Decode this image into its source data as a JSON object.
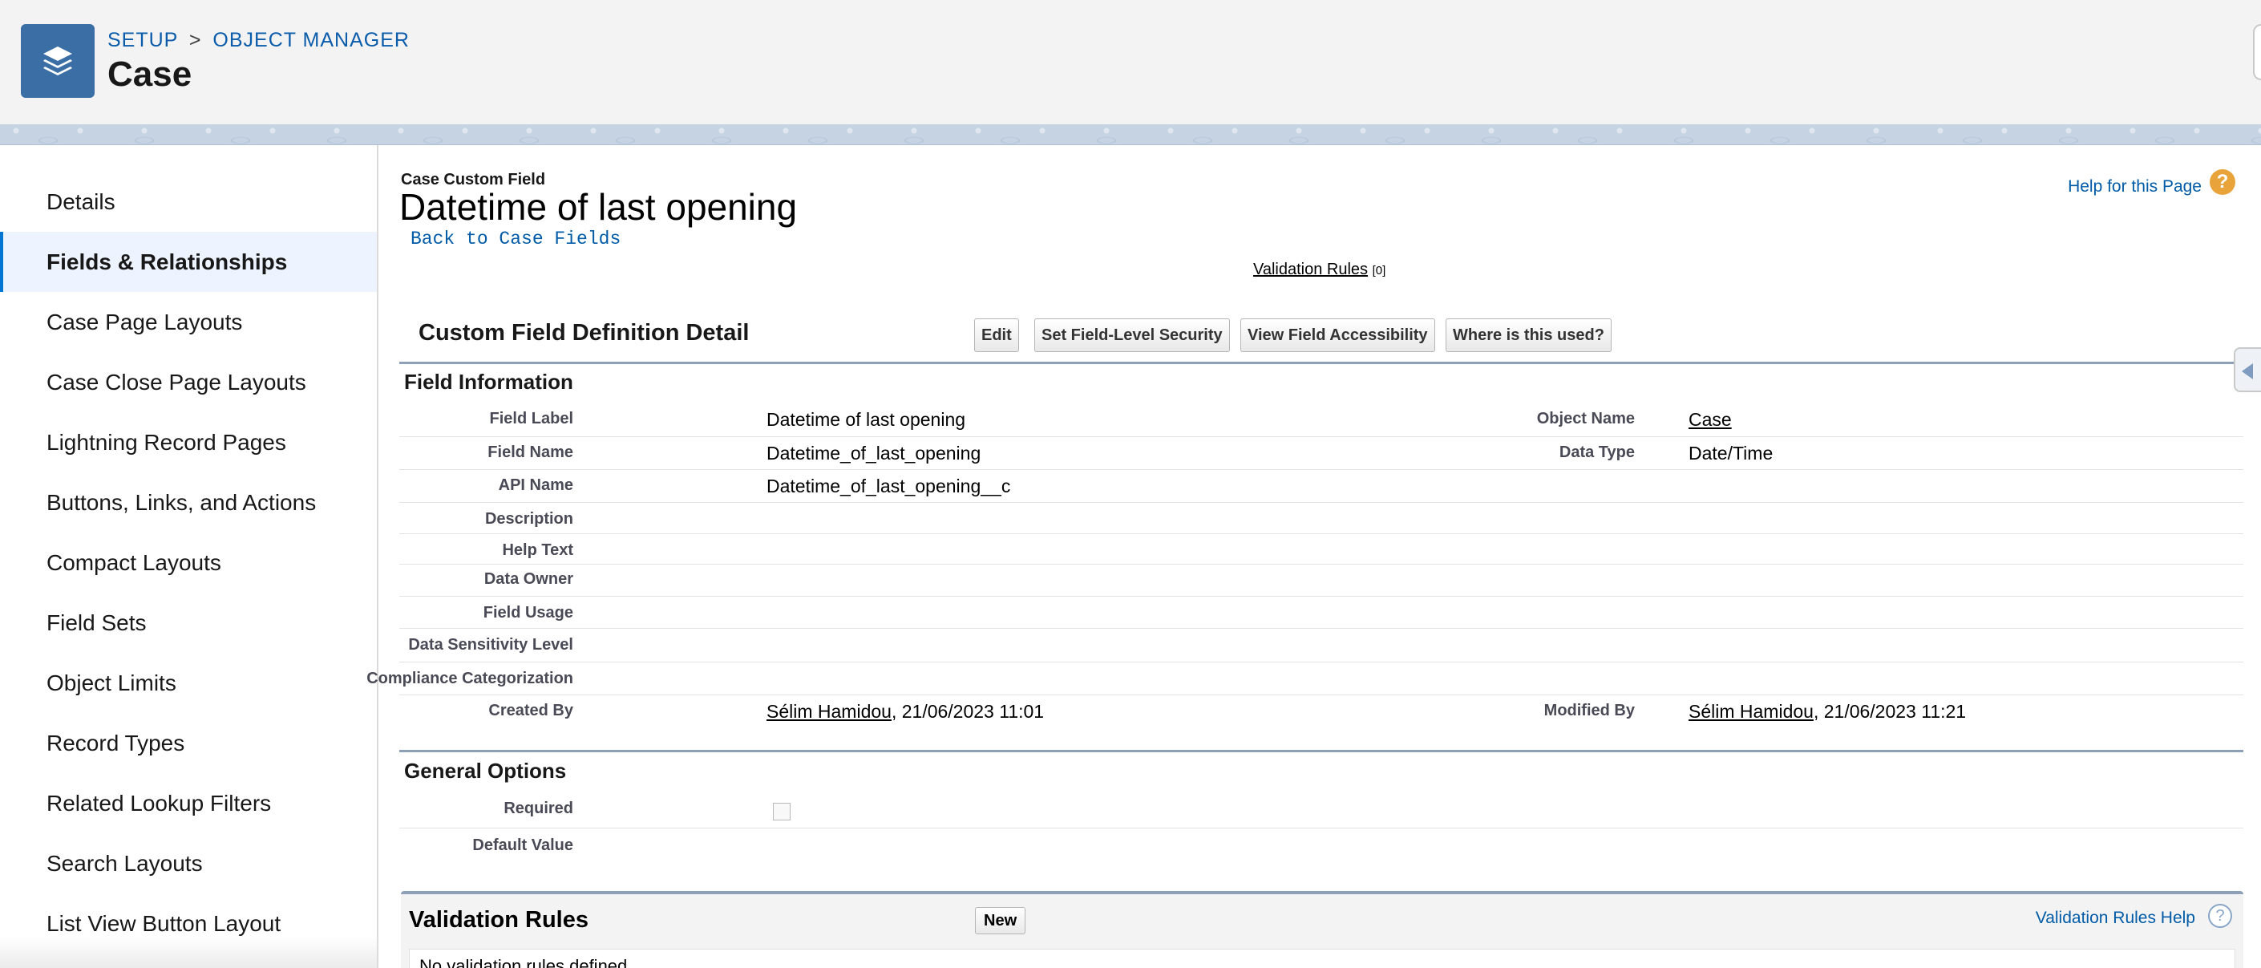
{
  "header": {
    "breadcrumb": [
      "SETUP",
      "OBJECT MANAGER"
    ],
    "separator": ">",
    "object_title": "Case"
  },
  "sidebar": {
    "items": [
      {
        "label": "Details"
      },
      {
        "label": "Fields & Relationships"
      },
      {
        "label": "Case Page Layouts"
      },
      {
        "label": "Case Close Page Layouts"
      },
      {
        "label": "Lightning Record Pages"
      },
      {
        "label": "Buttons, Links, and Actions"
      },
      {
        "label": "Compact Layouts"
      },
      {
        "label": "Field Sets"
      },
      {
        "label": "Object Limits"
      },
      {
        "label": "Record Types"
      },
      {
        "label": "Related Lookup Filters"
      },
      {
        "label": "Search Layouts"
      },
      {
        "label": "List View Button Layout"
      }
    ],
    "active": "Fields & Relationships"
  },
  "page": {
    "pre_title": "Case Custom Field",
    "title": "Datetime of last opening",
    "back_link": "Back to Case Fields",
    "help_link": "Help for this Page",
    "validation_rules_link": "Validation Rules",
    "validation_rules_count": "[0]"
  },
  "detail": {
    "section_title": "Custom Field Definition Detail",
    "buttons": {
      "edit": "Edit",
      "fls": "Set Field-Level Security",
      "accessibility": "View Field Accessibility",
      "where_used": "Where is this used?"
    },
    "field_info_heading": "Field Information",
    "labels": {
      "field_label": "Field Label",
      "field_name": "Field Name",
      "api_name": "API Name",
      "description": "Description",
      "help_text": "Help Text",
      "data_owner": "Data Owner",
      "field_usage": "Field Usage",
      "data_sensitivity": "Data Sensitivity Level",
      "compliance": "Compliance Categorization",
      "created_by": "Created By",
      "object_name": "Object Name",
      "data_type": "Data Type",
      "modified_by": "Modified By"
    },
    "values": {
      "field_label": "Datetime of last opening",
      "field_name": "Datetime_of_last_opening",
      "api_name": "Datetime_of_last_opening__c",
      "created_by_user": "Sélim Hamidou",
      "created_by_date": ", 21/06/2023 11:01",
      "object_name": "Case",
      "data_type": "Date/Time",
      "modified_by_user": "Sélim Hamidou",
      "modified_by_date": ", 21/06/2023 11:21"
    },
    "general_heading": "General Options",
    "general_labels": {
      "required": "Required",
      "default_value": "Default Value"
    },
    "required_checked": false
  },
  "validation_rules": {
    "title": "Validation Rules",
    "new_button": "New",
    "help_link": "Validation Rules Help",
    "empty_text": "No validation rules defined."
  }
}
